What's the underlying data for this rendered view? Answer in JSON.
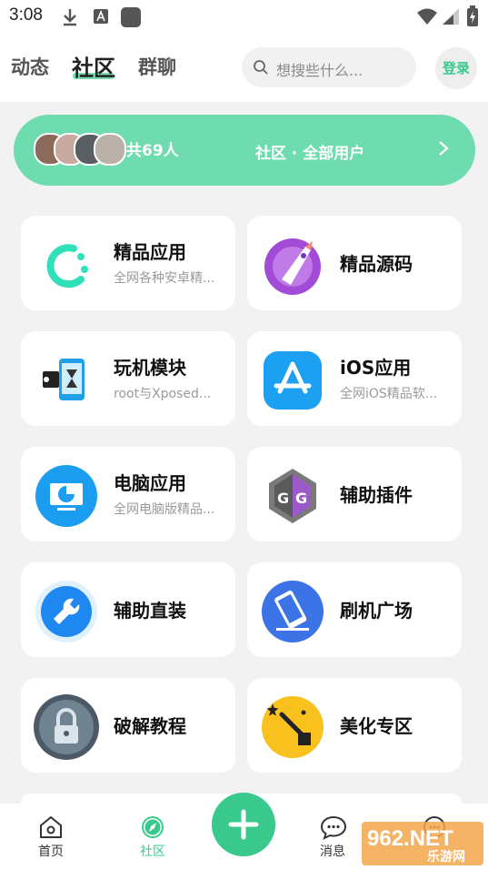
{
  "status": {
    "time": "3:08"
  },
  "header": {
    "tabs": [
      {
        "label": "动态",
        "active": false
      },
      {
        "label": "社区",
        "active": true
      },
      {
        "label": "群聊",
        "active": false
      }
    ],
    "search_placeholder": "想搜些什么...",
    "login_label": "登录"
  },
  "banner": {
    "count": "共69人",
    "title": "社区 · 全部用户"
  },
  "cards": [
    {
      "title": "精品应用",
      "desc": "全网各种安卓精...",
      "icon": "spinner-c-icon"
    },
    {
      "title": "精品源码",
      "desc": "",
      "icon": "rocket-icon"
    },
    {
      "title": "玩机模块",
      "desc": "root与Xposed...",
      "icon": "phone-module-icon"
    },
    {
      "title": "iOS应用",
      "desc": "全网iOS精品软...",
      "icon": "app-store-icon"
    },
    {
      "title": "电脑应用",
      "desc": "全网电脑版精品...",
      "icon": "monitor-icon"
    },
    {
      "title": "辅助插件",
      "desc": "",
      "icon": "game-guardian-icon"
    },
    {
      "title": "辅助直装",
      "desc": "",
      "icon": "wrench-icon"
    },
    {
      "title": "刷机广场",
      "desc": "",
      "icon": "flash-phone-icon"
    },
    {
      "title": "破解教程",
      "desc": "",
      "icon": "padlock-icon"
    },
    {
      "title": "美化专区",
      "desc": "",
      "icon": "magic-wand-icon"
    }
  ],
  "bottom_nav": [
    {
      "label": "首页",
      "icon": "home-icon"
    },
    {
      "label": "社区",
      "icon": "compass-icon",
      "active": true
    },
    {
      "label": "消息",
      "icon": "chat-icon"
    }
  ],
  "watermark": {
    "brand": "962.NET",
    "sub": "乐游网"
  },
  "colors": {
    "accent": "#39c98d",
    "banner": "#6fdcb0"
  }
}
